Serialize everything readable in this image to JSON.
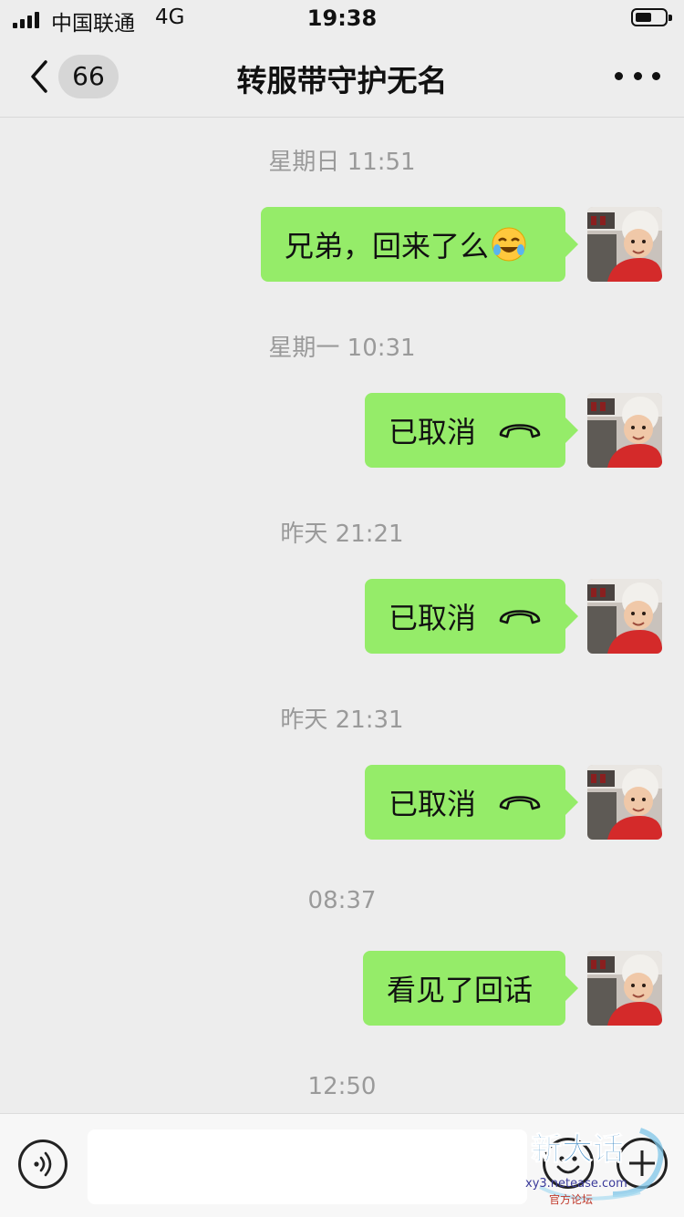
{
  "status_bar": {
    "carrier": "中国联通",
    "network": "4G",
    "time": "19:38"
  },
  "nav": {
    "back_count": "66",
    "title": "转服带守护无名"
  },
  "messages": [
    {
      "timestamp": "星期日 11:51",
      "text": "兄弟，回来了么",
      "emoji": "rolling-on-floor-laughing-icon"
    },
    {
      "timestamp": "星期一 10:31",
      "text": "已取消",
      "icon": "phone-hangup-icon"
    },
    {
      "timestamp": "昨天 21:21",
      "text": "已取消",
      "icon": "phone-hangup-icon"
    },
    {
      "timestamp": "昨天 21:31",
      "text": "已取消",
      "icon": "phone-hangup-icon"
    },
    {
      "timestamp": "08:37",
      "text": "看见了回话"
    },
    {
      "timestamp": "12:50"
    }
  ],
  "input": {
    "value": "",
    "placeholder": ""
  },
  "watermark": {
    "brand": "新大话",
    "domain": "xy3.netease.com",
    "subtitle": "官方论坛"
  },
  "colors": {
    "background": "#ededed",
    "bubble_self": "#95ec69",
    "timestamp": "#9a9a9a"
  }
}
